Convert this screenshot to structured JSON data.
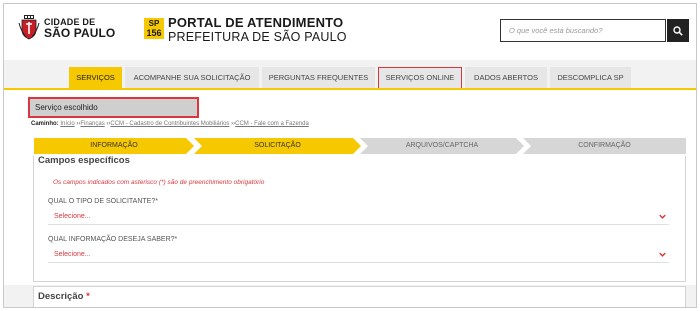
{
  "header": {
    "city_line1": "CIDADE DE",
    "city_line2": "SÃO PAULO",
    "badge_top": "SP",
    "badge_bottom": "156",
    "portal_title": "PORTAL DE ATENDIMENTO",
    "portal_subtitle": "PREFEITURA DE SÃO PAULO",
    "search_placeholder": "O que você está buscando?"
  },
  "nav": {
    "tabs": [
      {
        "label": "SERVIÇOS",
        "state": "active"
      },
      {
        "label": "ACOMPANHE SUA SOLICITAÇÃO",
        "state": "normal"
      },
      {
        "label": "PERGUNTAS FREQUENTES",
        "state": "normal"
      },
      {
        "label": "SERVIÇOS ONLINE",
        "state": "highlighted"
      },
      {
        "label": "DADOS ABERTOS",
        "state": "normal"
      },
      {
        "label": "DESCOMPLICA SP",
        "state": "normal"
      }
    ]
  },
  "service": {
    "chosen_label": "Serviço escolhido"
  },
  "breadcrumb": {
    "prefix": "Caminho:",
    "items": [
      "Início",
      "Finanças",
      "CCM - Cadastro de Contribuintes Mobiliários",
      "CCM - Fale com a Fazenda"
    ],
    "separator": "››"
  },
  "steps": [
    {
      "label": "INFORMAÇÃO",
      "state": "done"
    },
    {
      "label": "SOLICITAÇÃO",
      "state": "done"
    },
    {
      "label": "ARQUIVOS/CAPTCHA",
      "state": "todo"
    },
    {
      "label": "CONFIRMAÇÃO",
      "state": "todo"
    }
  ],
  "form": {
    "section_title": "Campos específicos",
    "required_note": "Os campos indicados com asterisco (*) são de preenchimento obrigatório",
    "field1_label": "QUAL O TIPO DE SOLICITANTE?*",
    "field1_value": "Selecione...",
    "field2_label": "QUAL INFORMAÇÃO DESEJA SABER?*",
    "field2_value": "Selecione...",
    "description_label": "Descrição",
    "description_marker": "*"
  },
  "colors": {
    "brand_yellow": "#f6c800",
    "highlight_red": "#d9363e",
    "inactive_grey": "#d6d6d6"
  },
  "icons": [
    "city-coat-of-arms-icon",
    "search-icon",
    "chevron-down-icon"
  ]
}
